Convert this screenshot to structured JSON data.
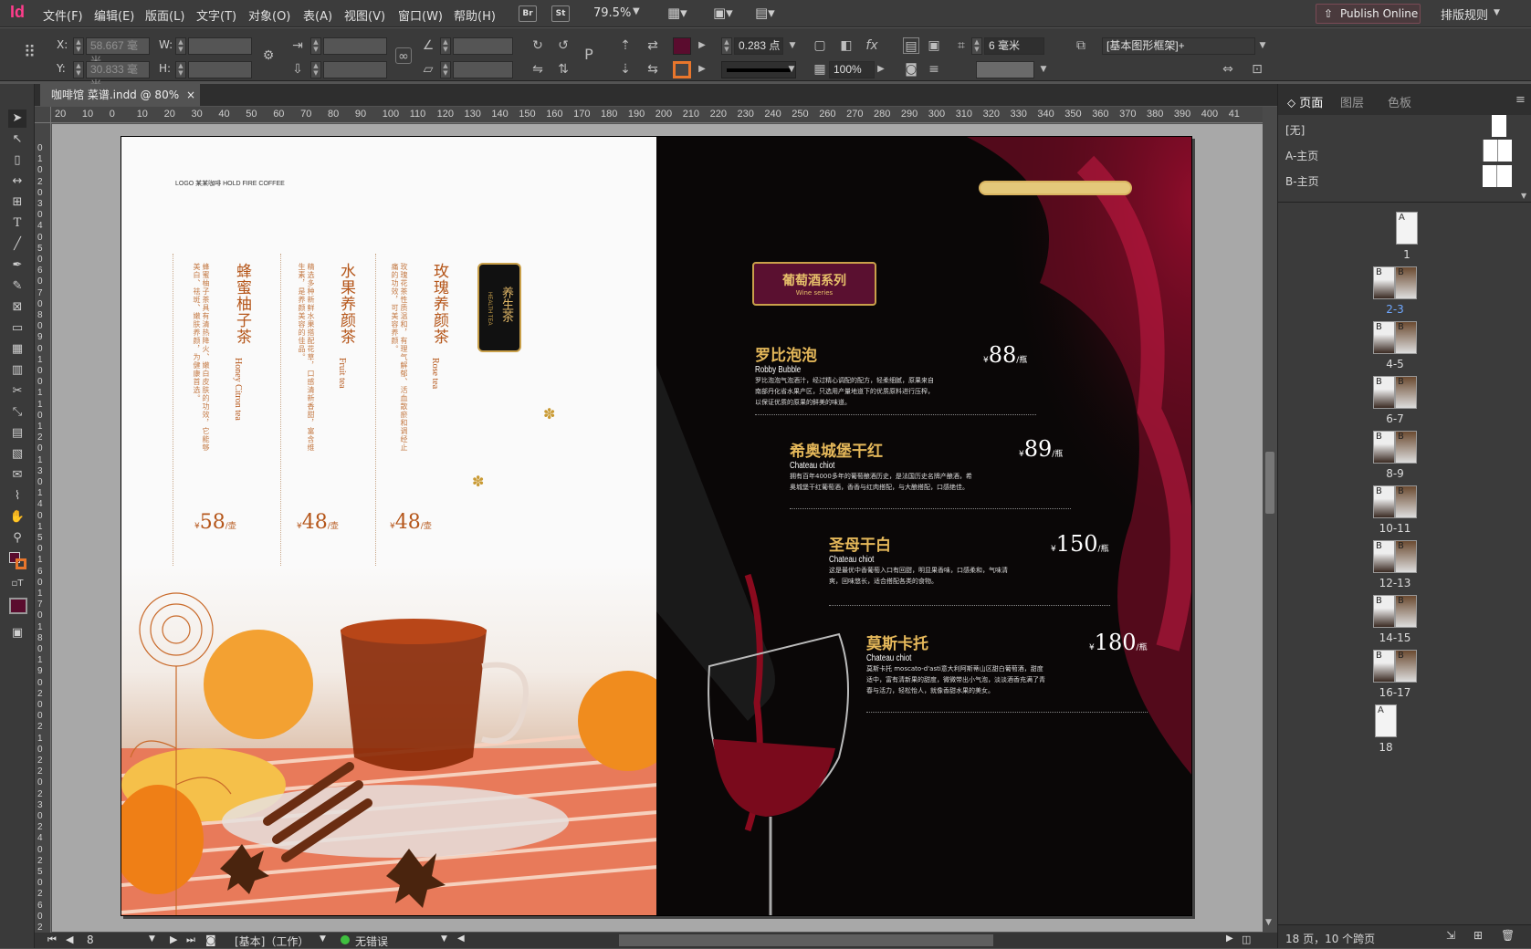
{
  "app": {
    "logo": "Id"
  },
  "menu": [
    "文件(F)",
    "编辑(E)",
    "版面(L)",
    "文字(T)",
    "对象(O)",
    "表(A)",
    "视图(V)",
    "窗口(W)",
    "帮助(H)"
  ],
  "bridge": {
    "br": "Br",
    "st": "St"
  },
  "zoom": "79.5%",
  "publish_label": "Publish Online",
  "workspace": "排版规则",
  "control": {
    "x_label": "X:",
    "x_value": "58.667 毫米",
    "y_label": "Y:",
    "y_value": "30.833 毫米",
    "w_label": "W:",
    "h_label": "H:",
    "stroke_weight": "0.283 点",
    "frame_offset": "6 毫米",
    "opacity": "100%",
    "object_style": "[基本图形框架]+"
  },
  "document_tab": "咖啡馆 菜谱.indd @ 80%",
  "ruler": {
    "h": [
      "20",
      "10",
      "0",
      "10",
      "20",
      "30",
      "40",
      "50",
      "60",
      "70",
      "80",
      "90",
      "100",
      "110",
      "120",
      "130",
      "140",
      "150",
      "160",
      "170",
      "180",
      "190",
      "200",
      "210",
      "220",
      "230",
      "240",
      "250",
      "260",
      "270",
      "280",
      "290",
      "300",
      "310",
      "320",
      "330",
      "340",
      "350",
      "360",
      "370",
      "380",
      "390",
      "400",
      "41"
    ],
    "v": [
      "0",
      "1",
      "0",
      "2",
      "0",
      "3",
      "0",
      "4",
      "0",
      "5",
      "0",
      "6",
      "0",
      "7",
      "0",
      "8",
      "0",
      "9",
      "0",
      "1",
      "0",
      "0",
      "1",
      "1",
      "0",
      "1",
      "2",
      "0",
      "1",
      "3",
      "0",
      "1",
      "4",
      "0",
      "1",
      "5",
      "0",
      "1",
      "6",
      "0",
      "1",
      "7",
      "0",
      "1",
      "8",
      "0",
      "1",
      "9",
      "0",
      "2",
      "0",
      "0",
      "2",
      "1",
      "0",
      "2",
      "2",
      "0",
      "2",
      "3",
      "0",
      "2",
      "4",
      "0",
      "2",
      "5",
      "0",
      "2",
      "6",
      "0",
      "2",
      "7",
      "0"
    ]
  },
  "left_page": {
    "header": "LOGO  某某咖啡  HOLD FIRE COFFEE",
    "badge": "养生茶",
    "badge_sub": "HEALTH TEA",
    "teas": [
      {
        "name": "蜂蜜柚子茶",
        "en": "Honey Citron tea",
        "desc": "蜂蜜柚子茶具有清热降火、嫩白皮肤的功效，它能够美白、祛斑、嫩肤养颜，为健康首选。",
        "price": "58",
        "unit": "/壶"
      },
      {
        "name": "水果养颜茶",
        "en": "Fruit tea",
        "desc": "精选多种新鲜水果搭配花草，口感清新香甜，富含维生素，是养颜美容的佳品。",
        "price": "48",
        "unit": "/壶"
      },
      {
        "name": "玫瑰养颜茶",
        "en": "Rose tea",
        "desc": "玫瑰花茶性质温和，有理气解郁、活血散瘀和调经止痛的功效，可美容养颜。",
        "price": "48",
        "unit": "/壶"
      }
    ],
    "currency": "¥"
  },
  "right_page": {
    "series_title": "葡萄酒系列",
    "series_sub": "Wine series",
    "wines": [
      {
        "name": "罗比泡泡",
        "en": "Robby Bubble",
        "desc": "罗比泡泡气泡酒汁，经过精心调配的配方，轻柔细腻，原果来自南部丹化省水果产区，只选用产量地道下的优质原料进行压榨，以保证优质的原果的鲜美的味道。",
        "price": "88",
        "unit": "/瓶"
      },
      {
        "name": "希奥城堡干红",
        "en": "Chateau chiot",
        "desc": "拥有百年4000多年的葡萄酿酒历史，是法国历史名牌产酿酒，希奥城堡干红葡萄酒，香香与红肉搭配，与大酿搭配，口感绝佳。",
        "price": "89",
        "unit": "/瓶"
      },
      {
        "name": "圣母干白",
        "en": "Chateau chiot",
        "desc": "这是最优中香葡萄入口有回甜，明显果香味，口感柔和，气味清爽，回味悠长，适合搭配各类的食物。",
        "price": "150",
        "unit": "/瓶"
      },
      {
        "name": "莫斯卡托",
        "en": "Chateau chiot",
        "desc": "莫斯卡托 moscato-d'asti意大利阿斯蒂山区甜白葡萄酒，甜度适中，富有清新果的甜度，微微带出小气泡，淡淡酒香充满了青春与活力，轻松怡人，就像香甜水果的美女。",
        "price": "180",
        "unit": "/瓶"
      }
    ],
    "currency": "¥"
  },
  "status": {
    "page": "8",
    "style": "[基本]（工作）",
    "preflight": "无错误"
  },
  "panel": {
    "tabs": [
      "页面",
      "图层",
      "色板"
    ],
    "masters": [
      "[无]",
      "A-主页",
      "B-主页"
    ],
    "pages": [
      {
        "label": "1",
        "master": "A"
      },
      {
        "label": "2-3",
        "master": "B"
      },
      {
        "label": "4-5",
        "master": "B"
      },
      {
        "label": "6-7",
        "master": "B"
      },
      {
        "label": "8-9",
        "master": "B"
      },
      {
        "label": "10-11",
        "master": "B"
      },
      {
        "label": "12-13",
        "master": "B"
      },
      {
        "label": "14-15",
        "master": "B"
      },
      {
        "label": "16-17",
        "master": "B"
      },
      {
        "label": "18",
        "master": "A"
      }
    ],
    "footer": "18 页，10 个跨页"
  }
}
